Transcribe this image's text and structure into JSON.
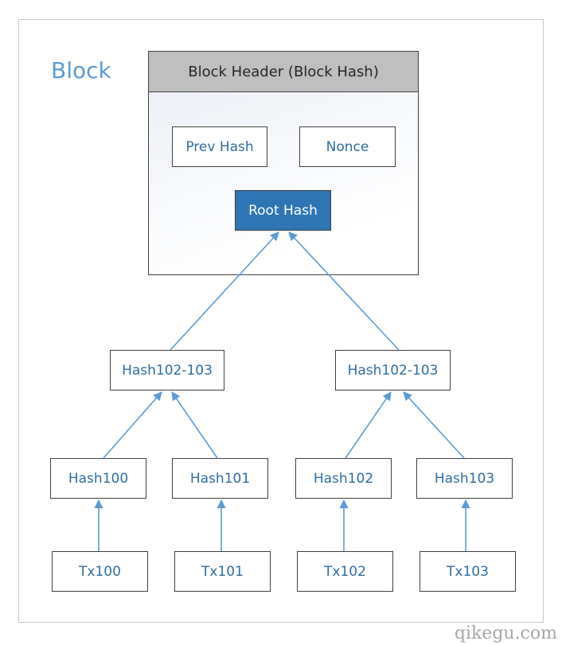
{
  "diagram": {
    "title": "Block",
    "header_label": "Block Header (Block Hash)",
    "header_fields": {
      "prev_hash": "Prev Hash",
      "nonce": "Nonce",
      "root_hash": "Root Hash"
    },
    "level2": [
      "Hash102-103",
      "Hash102-103"
    ],
    "level1": [
      "Hash100",
      "Hash101",
      "Hash102",
      "Hash103"
    ],
    "transactions": [
      "Tx100",
      "Tx101",
      "Tx102",
      "Tx103"
    ],
    "edges": [
      {
        "from": "Hash102-103 (left)",
        "to": "Root Hash"
      },
      {
        "from": "Hash102-103 (right)",
        "to": "Root Hash"
      },
      {
        "from": "Hash100",
        "to": "Hash102-103 (left)"
      },
      {
        "from": "Hash101",
        "to": "Hash102-103 (left)"
      },
      {
        "from": "Hash102",
        "to": "Hash102-103 (right)"
      },
      {
        "from": "Hash103",
        "to": "Hash102-103 (right)"
      },
      {
        "from": "Tx100",
        "to": "Hash100"
      },
      {
        "from": "Tx101",
        "to": "Hash101"
      },
      {
        "from": "Tx102",
        "to": "Hash102"
      },
      {
        "from": "Tx103",
        "to": "Hash103"
      }
    ]
  },
  "colors": {
    "title": "#5b9bd5",
    "node_text": "#2e6da4",
    "root_fill": "#2e75b6",
    "arrow": "#5b9bd5",
    "header_bar": "#bfbfbf"
  },
  "watermark": "qikegu.com"
}
